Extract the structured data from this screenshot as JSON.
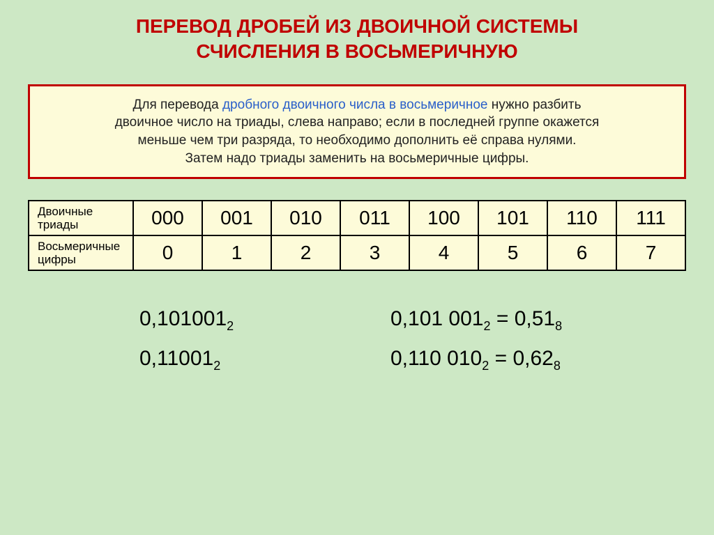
{
  "title_line1": "ПЕРЕВОД ДРОБЕЙ ИЗ ДВОИЧНОЙ СИСТЕМЫ",
  "title_line2": "СЧИСЛЕНИЯ В ВОСЬМЕРИЧНУЮ",
  "info": {
    "p1_pre": "Для перевода ",
    "p1_hl": "дробного двоичного числа в восьмеричное",
    "p1_post": " нужно разбить",
    "p2": "двоичное число на триады, слева направо; если в последней группе окажется",
    "p3": "меньше чем три разряда, то необходимо дополнить её справа нулями.",
    "p4": "Затем надо триады заменить на восьмеричные цифры."
  },
  "table": {
    "row1_label": "Двоичные триады",
    "row1": [
      "000",
      "001",
      "010",
      "011",
      "100",
      "101",
      "110",
      "111"
    ],
    "row2_label": "Восьмеричные цифры",
    "row2": [
      "0",
      "1",
      "2",
      "3",
      "4",
      "5",
      "6",
      "7"
    ]
  },
  "ex": {
    "a1": "0,101001",
    "a1s": "2",
    "a2a": "0,101 001",
    "a2as": "2",
    "a2eq": " = ",
    "a2b": "0,51",
    "a2bs": "8",
    "b1": "0,11001",
    "b1s": "2",
    "b2a": "0,110 010",
    "b2as": "2",
    "b2eq": " = ",
    "b2b": "0,62",
    "b2bs": "8"
  }
}
